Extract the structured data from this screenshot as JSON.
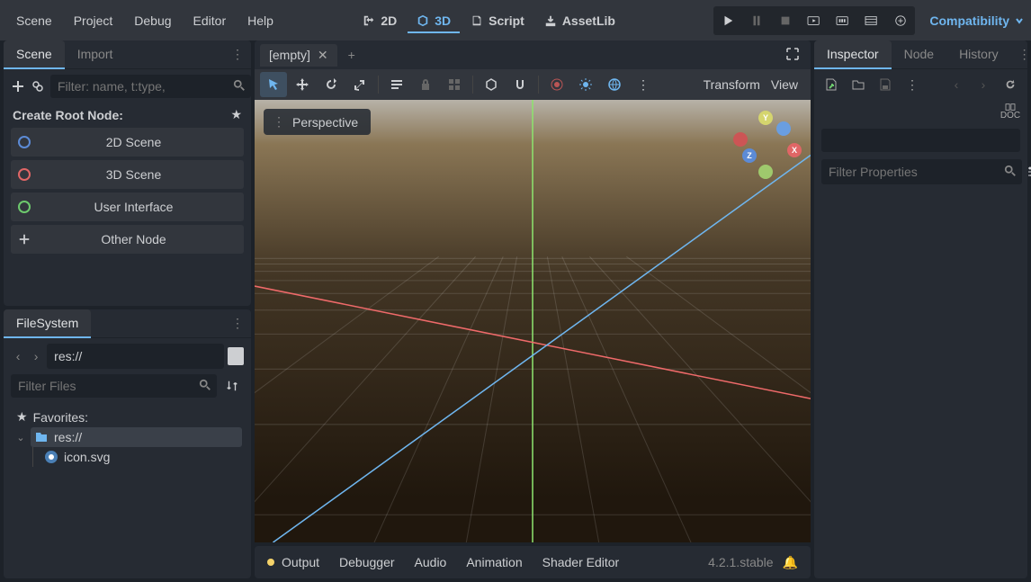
{
  "menu": [
    "Scene",
    "Project",
    "Debug",
    "Editor",
    "Help"
  ],
  "center": {
    "tabs": [
      {
        "label": "2D",
        "active": false
      },
      {
        "label": "3D",
        "active": true
      },
      {
        "label": "Script",
        "active": false
      },
      {
        "label": "AssetLib",
        "active": false
      }
    ]
  },
  "renderer": "Compatibility",
  "leftTabs": {
    "scene": "Scene",
    "import": "Import"
  },
  "filter": {
    "scene_placeholder": "Filter: name, t:type,"
  },
  "root": {
    "header": "Create Root Node:",
    "items": [
      {
        "label": "2D Scene",
        "color": "#5c8bd6"
      },
      {
        "label": "3D Scene",
        "color": "#e06666"
      },
      {
        "label": "User Interface",
        "color": "#6dc96d"
      },
      {
        "label": "Other Node",
        "plus": true
      }
    ]
  },
  "fs": {
    "tab": "FileSystem",
    "path": "res://",
    "filter_placeholder": "Filter Files",
    "favorites": "Favorites:",
    "root_label": "res://",
    "file1": "icon.svg"
  },
  "viewport": {
    "tab": "[empty]",
    "perspective": "Perspective",
    "transform": "Transform",
    "view": "View"
  },
  "bottom": {
    "tabs": [
      "Output",
      "Debugger",
      "Audio",
      "Animation",
      "Shader Editor"
    ],
    "version": "4.2.1.stable"
  },
  "inspector": {
    "tabs": [
      "Inspector",
      "Node",
      "History"
    ],
    "filter_placeholder": "Filter Properties"
  }
}
